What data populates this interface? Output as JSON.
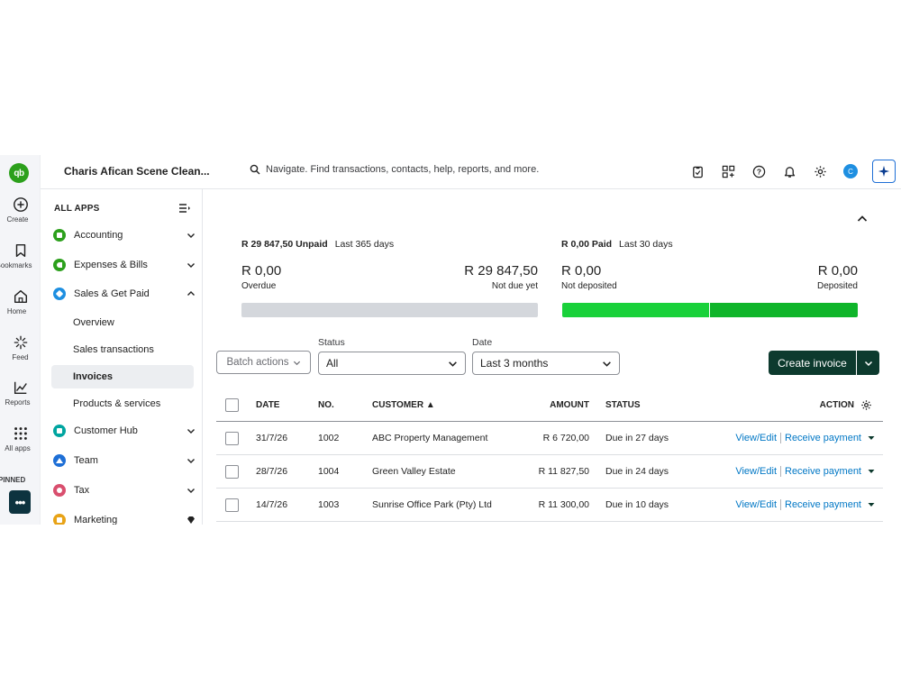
{
  "rail": {
    "items": [
      {
        "label": "Create",
        "icon": "plus-circle-icon"
      },
      {
        "label": "Bookmarks",
        "icon": "bookmark-icon"
      },
      {
        "label": "Home",
        "icon": "home-icon"
      },
      {
        "label": "Feed",
        "icon": "feed-icon"
      },
      {
        "label": "Reports",
        "icon": "chart-icon"
      },
      {
        "label": "All apps",
        "icon": "grid-icon"
      }
    ],
    "pinned_label": "PINNED",
    "more_label": "•••"
  },
  "header": {
    "logo_text": "qb",
    "company": "Charis Afican Scene Clean...",
    "search_placeholder": "Navigate. Find transactions, contacts, help, reports, and more.",
    "avatar_initial": "C"
  },
  "sidebar": {
    "heading": "ALL APPS",
    "groups": [
      {
        "label": "Accounting",
        "color": "#2ca01c"
      },
      {
        "label": "Expenses & Bills",
        "color": "#2ca01c"
      },
      {
        "label": "Sales & Get Paid",
        "color": "#1e8fe1"
      },
      {
        "label": "Customer Hub",
        "color": "#00a5a0"
      },
      {
        "label": "Team",
        "color": "#1e6fd6"
      },
      {
        "label": "Tax",
        "color": "#d94f6e"
      },
      {
        "label": "Marketing",
        "color": "#e8a317"
      }
    ],
    "sub_items": [
      {
        "label": "Overview"
      },
      {
        "label": "Sales transactions"
      },
      {
        "label": "Invoices"
      },
      {
        "label": "Products & services"
      }
    ]
  },
  "summary": {
    "unpaid": {
      "title": "R 29 847,50 Unpaid",
      "period": "Last 365 days",
      "overdue_amount": "R 0,00",
      "overdue_label": "Overdue",
      "notdue_amount": "R 29 847,50",
      "notdue_label": "Not due yet"
    },
    "paid": {
      "title": "R 0,00 Paid",
      "period": "Last 30 days",
      "notdeposited_amount": "R 0,00",
      "notdeposited_label": "Not deposited",
      "deposited_amount": "R 0,00",
      "deposited_label": "Deposited"
    }
  },
  "filters": {
    "batch_label": "Batch actions",
    "status_label": "Status",
    "status_value": "All",
    "date_label": "Date",
    "date_value": "Last 3 months",
    "create_label": "Create invoice"
  },
  "table": {
    "columns": {
      "date": "DATE",
      "no": "NO.",
      "customer": "CUSTOMER ▲",
      "amount": "AMOUNT",
      "status": "STATUS",
      "action": "ACTION"
    },
    "rows": [
      {
        "date": "31/7/26",
        "no": "1002",
        "customer": "ABC Property Management",
        "amount": "R 6 720,00",
        "status": "Due in 27 days",
        "view": "View/Edit",
        "receive": "Receive payment"
      },
      {
        "date": "28/7/26",
        "no": "1004",
        "customer": "Green Valley Estate",
        "amount": "R 11 827,50",
        "status": "Due in 24 days",
        "view": "View/Edit",
        "receive": "Receive payment"
      },
      {
        "date": "14/7/26",
        "no": "1003",
        "customer": "Sunrise Office Park (Pty) Ltd",
        "amount": "R 11 300,00",
        "status": "Due in 10 days",
        "view": "View/Edit",
        "receive": "Receive payment"
      }
    ]
  },
  "colors": {
    "brand_green": "#2ca01c",
    "dark_green": "#0d3a2e",
    "link_blue": "#0077c5",
    "bar_gray": "#d4d7dc",
    "bar_light_green": "#19d13a",
    "bar_green": "#0fb52a"
  }
}
